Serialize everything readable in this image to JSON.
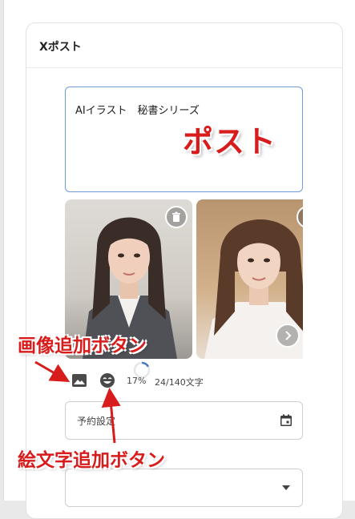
{
  "card": {
    "title": "Xポスト"
  },
  "composer": {
    "text": "AIイラスト　秘書シリーズ"
  },
  "counter": {
    "percent": "17%",
    "chars": "24/140文字",
    "progress": 0.17
  },
  "schedule": {
    "label": "予約設定"
  },
  "annotations": {
    "post": "ポスト",
    "image_button": "画像追加ボタン",
    "emoji_button": "絵文字追加ボタン"
  },
  "colors": {
    "annotation": "#d81b1b",
    "focus_border": "#6f9bd8",
    "progress": "#4a78c2"
  },
  "icons": {
    "delete": "trash-icon",
    "next": "chevron-right-icon",
    "image": "image-icon",
    "emoji": "emoji-icon",
    "calendar": "calendar-icon",
    "dropdown": "caret-down-icon"
  }
}
